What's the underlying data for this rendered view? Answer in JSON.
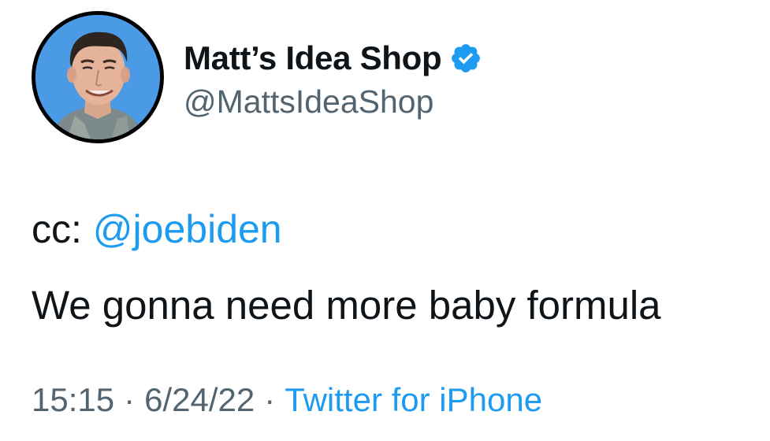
{
  "author": {
    "display_name": "Matt’s Idea Shop",
    "handle": "@MattsIdeaShop",
    "verified_icon": "verified-badge-icon",
    "avatar_icon": "avatar-photo"
  },
  "tweet": {
    "cc_prefix": "cc: ",
    "mention": "@joebiden",
    "body": "We gonna need more baby formula"
  },
  "meta": {
    "time": "15:15",
    "separator": "·",
    "date": "6/24/22",
    "source": "Twitter for iPhone"
  },
  "colors": {
    "link": "#1d9bf0",
    "secondary_text": "#536471",
    "primary_text": "#0f1419",
    "avatar_bg": "#4a9ae6"
  }
}
